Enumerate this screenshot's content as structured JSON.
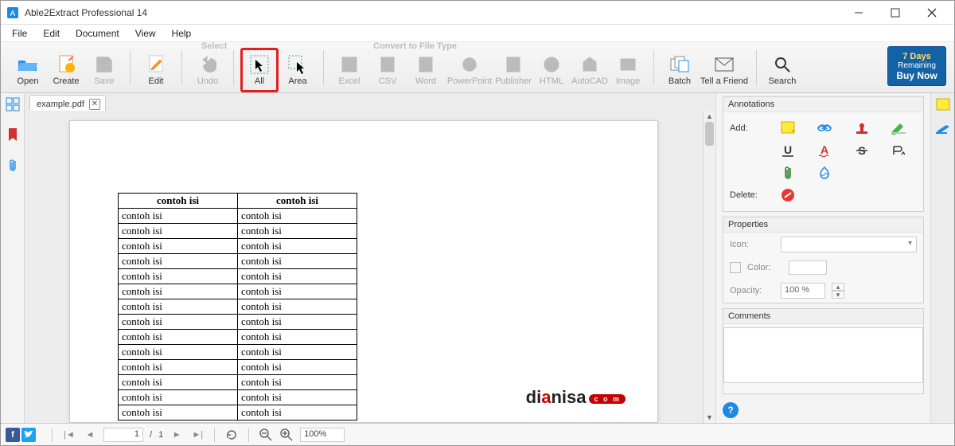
{
  "window": {
    "title": "Able2Extract Professional 14"
  },
  "menubar": [
    "File",
    "Edit",
    "Document",
    "View",
    "Help"
  ],
  "toolbar": {
    "group_select_label": "Select",
    "group_convert_label": "Convert to File Type",
    "buttons": {
      "open": "Open",
      "create": "Create",
      "save": "Save",
      "edit": "Edit",
      "undo": "Undo",
      "all": "All",
      "area": "Area",
      "excel": "Excel",
      "csv": "CSV",
      "word": "Word",
      "ppt": "PowerPoint",
      "publisher": "Publisher",
      "html": "HTML",
      "autocad": "AutoCAD",
      "image": "Image",
      "batch": "Batch",
      "tellfriend": "Tell a Friend",
      "search": "Search"
    },
    "buynow": {
      "l1": "7 Days",
      "l2": "Remaining",
      "l3": "Buy Now"
    }
  },
  "tab": {
    "filename": "example.pdf"
  },
  "document": {
    "headers": [
      "contoh isi",
      "contoh isi"
    ],
    "rows": [
      [
        "contoh isi",
        "contoh isi"
      ],
      [
        "contoh isi",
        "contoh isi"
      ],
      [
        "contoh isi",
        "contoh isi"
      ],
      [
        "contoh isi",
        "contoh isi"
      ],
      [
        "contoh isi",
        "contoh isi"
      ],
      [
        "contoh isi",
        "contoh isi"
      ],
      [
        "contoh isi",
        "contoh isi"
      ],
      [
        "contoh isi",
        "contoh isi"
      ],
      [
        "contoh isi",
        "contoh isi"
      ],
      [
        "contoh isi",
        "contoh isi"
      ],
      [
        "contoh isi",
        "contoh isi"
      ],
      [
        "contoh isi",
        "contoh isi"
      ],
      [
        "contoh isi",
        "contoh isi"
      ],
      [
        "contoh isi",
        "contoh isi"
      ]
    ],
    "watermark": {
      "part1": "di",
      "part2": "a",
      "part3": "nisa",
      "pill": "c o m"
    }
  },
  "rightpanel": {
    "annotations_hd": "Annotations",
    "add_label": "Add:",
    "delete_label": "Delete:",
    "properties_hd": "Properties",
    "icon_label": "Icon:",
    "color_label": "Color:",
    "opacity_label": "Opacity:",
    "opacity_value": "100 %",
    "comments_hd": "Comments"
  },
  "statusbar": {
    "page_current": "1",
    "page_sep": "/",
    "page_total": "1",
    "zoom": "100%"
  }
}
